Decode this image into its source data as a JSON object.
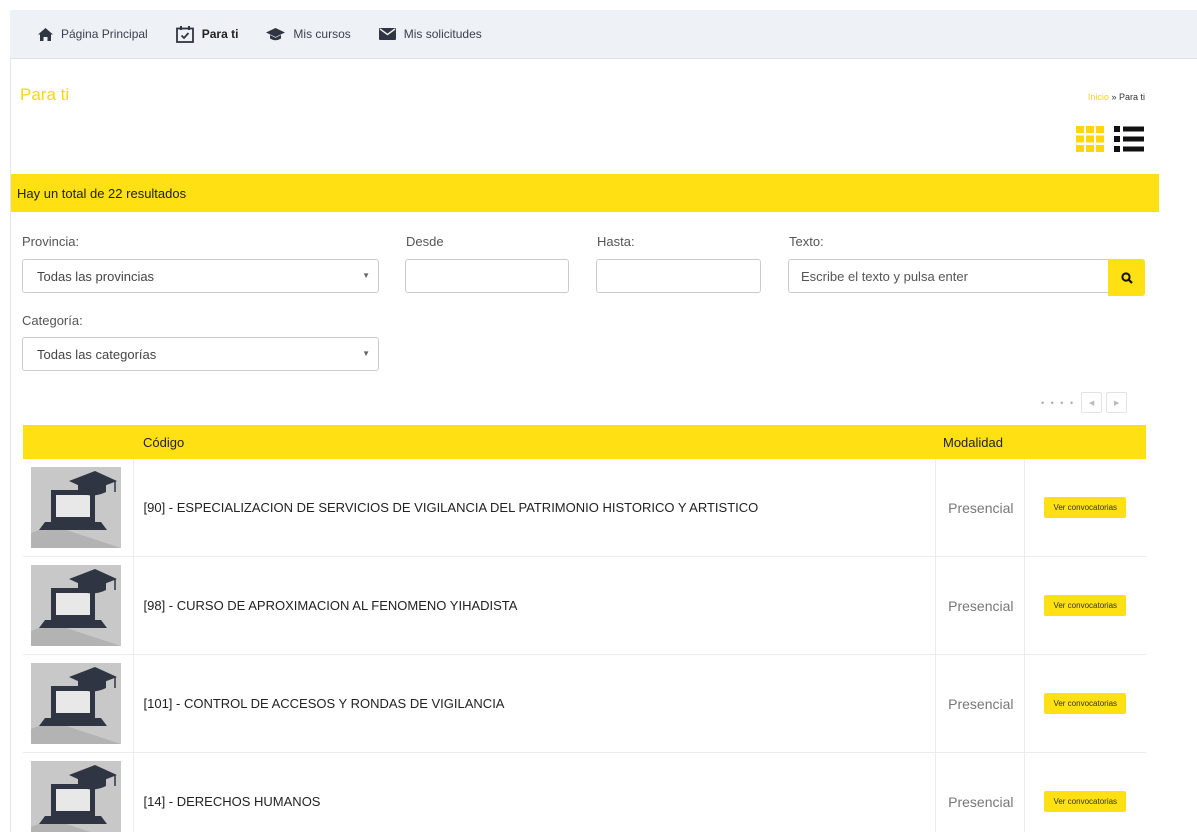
{
  "nav": {
    "items": [
      {
        "label": "Página Principal",
        "icon": "home-icon"
      },
      {
        "label": "Para ti",
        "icon": "calendar-check-icon"
      },
      {
        "label": "Mis cursos",
        "icon": "graduation-cap-icon"
      },
      {
        "label": "Mis solicitudes",
        "icon": "envelope-icon"
      }
    ]
  },
  "page": {
    "title": "Para ti",
    "breadcrumb": {
      "link": "Inicio",
      "separator": "»",
      "current": "Para ti"
    }
  },
  "results": {
    "text": "Hay un total de 22 resultados"
  },
  "filters": {
    "provincia_label": "Provincia:",
    "provincia_value": "Todas las provincias",
    "desde_label": "Desde",
    "hasta_label": "Hasta:",
    "texto_label": "Texto:",
    "texto_placeholder": "Escribe el texto y pulsa enter",
    "categoria_label": "Categoría:",
    "categoria_value": "Todas las categorías"
  },
  "table": {
    "headers": {
      "image": "",
      "codigo": "Código",
      "modalidad": "Modalidad",
      "action": ""
    },
    "rows": [
      {
        "codigo": "[90] - ESPECIALIZACION DE SERVICIOS DE VIGILANCIA DEL PATRIMONIO HISTORICO Y ARTISTICO",
        "modalidad": "Presencial",
        "button": "Ver convocatorias"
      },
      {
        "codigo": "[98] - CURSO DE APROXIMACION AL FENOMENO YIHADISTA",
        "modalidad": "Presencial",
        "button": "Ver convocatorias"
      },
      {
        "codigo": "[101] - CONTROL DE ACCESOS Y RONDAS DE VIGILANCIA",
        "modalidad": "Presencial",
        "button": "Ver convocatorias"
      },
      {
        "codigo": "[14] - DERECHOS HUMANOS",
        "modalidad": "Presencial",
        "button": "Ver convocatorias"
      }
    ]
  },
  "colors": {
    "accent": "#ffe012",
    "title": "#f5d90a",
    "nav_bg": "#eef1f5"
  }
}
